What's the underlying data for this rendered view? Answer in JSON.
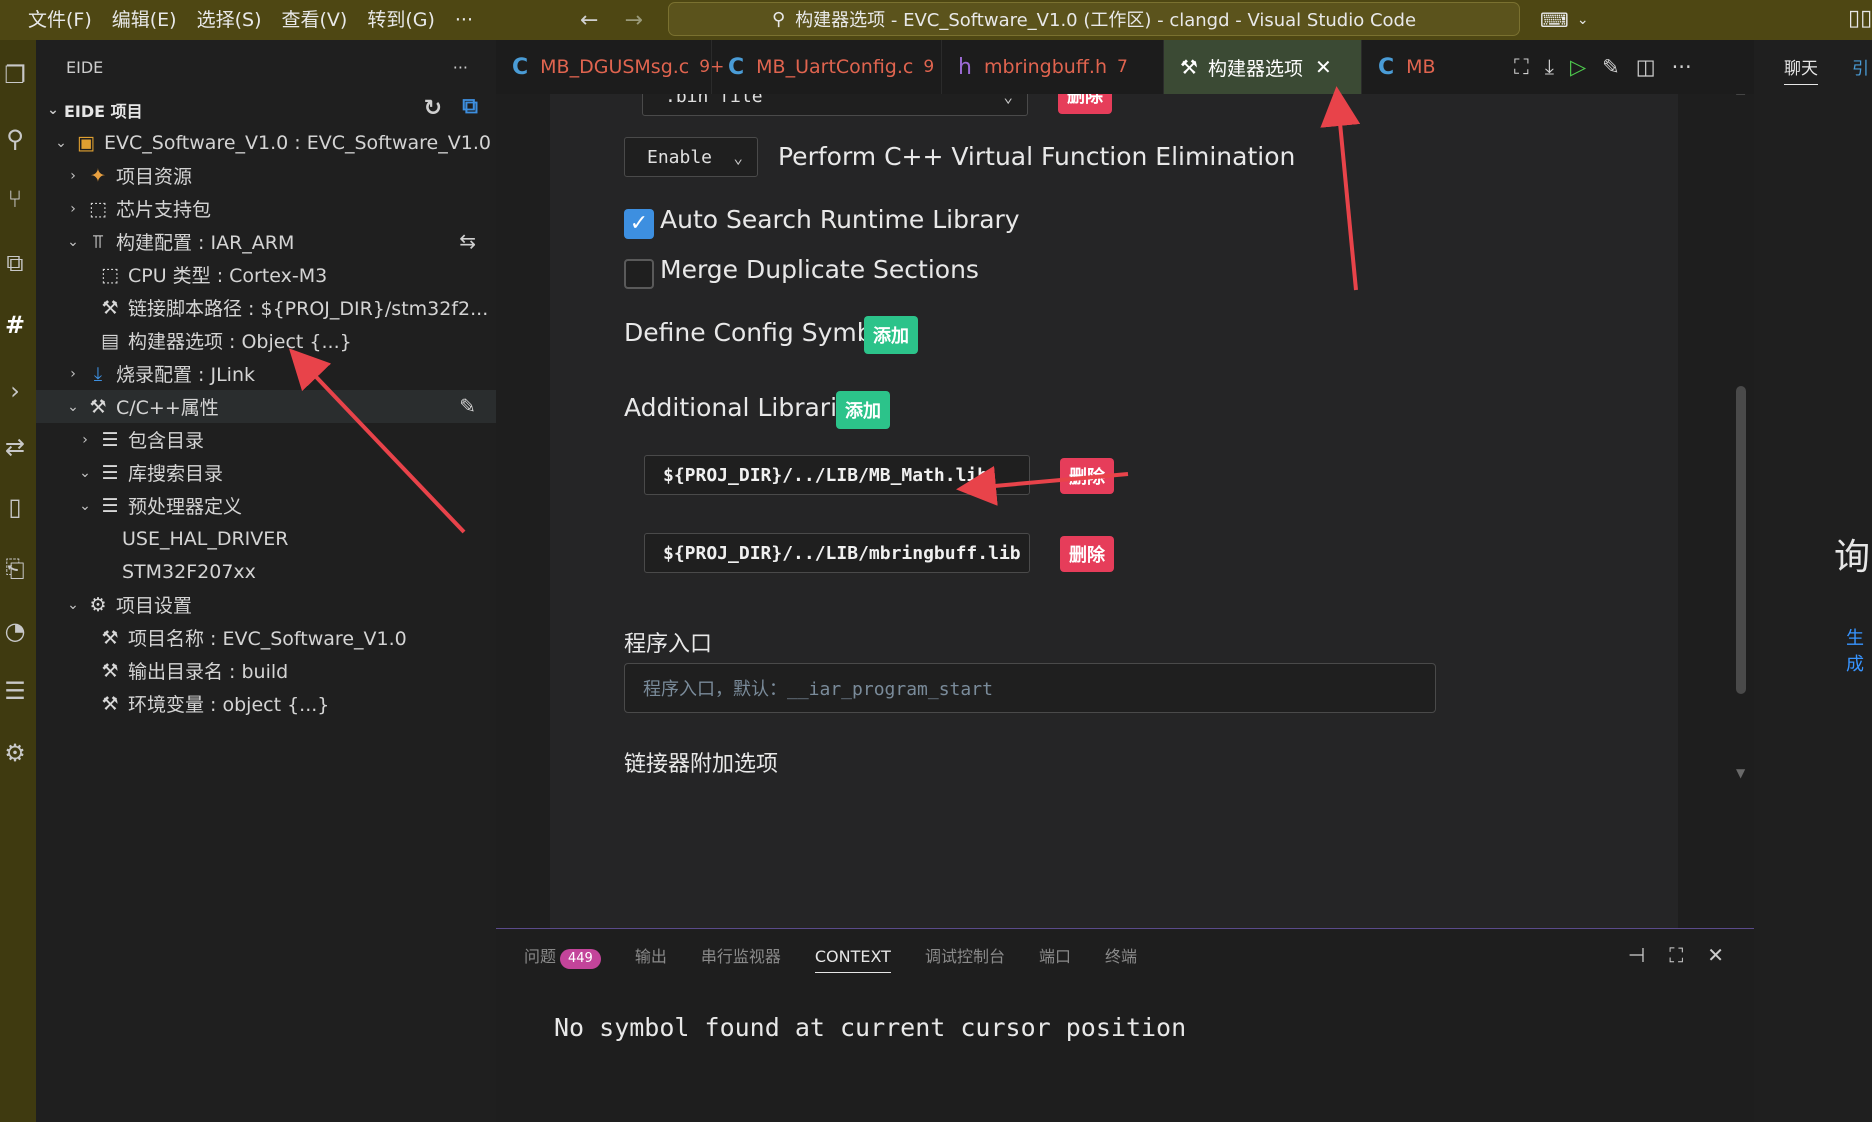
{
  "titlebar": {
    "menu": [
      "文件(F)",
      "编辑(E)",
      "选择(S)",
      "查看(V)",
      "转到(G)",
      "···"
    ],
    "window_title": "构建器选项 - EVC_Software_V1.0 (工作区) - clangd - Visual Studio Code"
  },
  "sidebar": {
    "title": "EIDE",
    "more": "···",
    "section_title": "EIDE 项目",
    "tree": [
      {
        "label": "EVC_Software_V1.0 : EVC_Software_V1.0",
        "icon": "project-icon"
      },
      {
        "label": "项目资源",
        "icon": "resources-icon"
      },
      {
        "label": "芯片支持包",
        "icon": "chip-icon"
      },
      {
        "label": "构建配置 : IAR_ARM",
        "icon": "build-config-icon"
      },
      {
        "label": "CPU 类型 : Cortex-M3",
        "icon": "cpu-icon"
      },
      {
        "label": "链接脚本路径 : ${PROJ_DIR}/stm32f2...",
        "icon": "wrench-icon"
      },
      {
        "label": "构建器选项 : Object {...}",
        "icon": "builder-options-icon"
      },
      {
        "label": "烧录配置 : JLink",
        "icon": "flash-download-icon"
      },
      {
        "label": "C/C++属性",
        "icon": "wrench-icon"
      },
      {
        "label": "包含目录",
        "icon": "folder-list-icon"
      },
      {
        "label": "库搜索目录",
        "icon": "folder-list-icon"
      },
      {
        "label": "预处理器定义",
        "icon": "folder-list-icon"
      },
      {
        "label": "USE_HAL_DRIVER",
        "icon": ""
      },
      {
        "label": "STM32F207xx",
        "icon": ""
      },
      {
        "label": "项目设置",
        "icon": "gear-icon"
      },
      {
        "label": "项目名称 : EVC_Software_V1.0",
        "icon": "wrench-icon"
      },
      {
        "label": "输出目录名 : build",
        "icon": "wrench-icon"
      },
      {
        "label": "环境变量 : object {...}",
        "icon": "wrench-icon"
      }
    ]
  },
  "tabs": [
    {
      "label": "MB_DGUSMsg.c",
      "badge": "9+",
      "type": "c"
    },
    {
      "label": "MB_UartConfig.c",
      "badge": "9",
      "type": "c"
    },
    {
      "label": "mbringbuff.h",
      "badge": "7",
      "type": "h"
    },
    {
      "label": "构建器选项",
      "badge": "",
      "type": "settings"
    },
    {
      "label": "MB",
      "badge": "",
      "type": "c"
    }
  ],
  "editor": {
    "top_select_value": ".bin file",
    "top_delete_label": "删除",
    "vfe_select_value": "Enable",
    "vfe_label": "Perform C++ Virtual Function Elimination",
    "auto_search_label": "Auto Search Runtime Library",
    "auto_search_checked": true,
    "merge_label": "Merge Duplicate Sections",
    "merge_checked": false,
    "define_symbols_label": "Define Config Symbols",
    "add_label": "添加",
    "additional_libs_label": "Additional Libraries",
    "libraries": [
      "${PROJ_DIR}/../LIB/MB_Math.lib",
      "${PROJ_DIR}/../LIB/mbringbuff.lib"
    ],
    "delete_label": "删除",
    "entry_label": "程序入口",
    "entry_placeholder": "程序入口，默认：__iar_program_start",
    "linker_label": "链接器附加选项"
  },
  "panel": {
    "tabs": [
      "问题",
      "输出",
      "串行监视器",
      "CONTEXT",
      "调试控制台",
      "端口",
      "终端"
    ],
    "problems_count": "449",
    "active_tab": "CONTEXT",
    "output_text": "No symbol found at current cursor position"
  },
  "auxbar": {
    "tab_label": "聊天",
    "tab2_label": "引",
    "big_text": "询",
    "link_text": "生成"
  },
  "colors": {
    "titlebar": "#4e4713",
    "accent_green": "#2cc38a",
    "danger_red": "#e63d5a",
    "annotation_arrow": "#e8434a",
    "checkbox_blue": "#3d8fe0"
  }
}
